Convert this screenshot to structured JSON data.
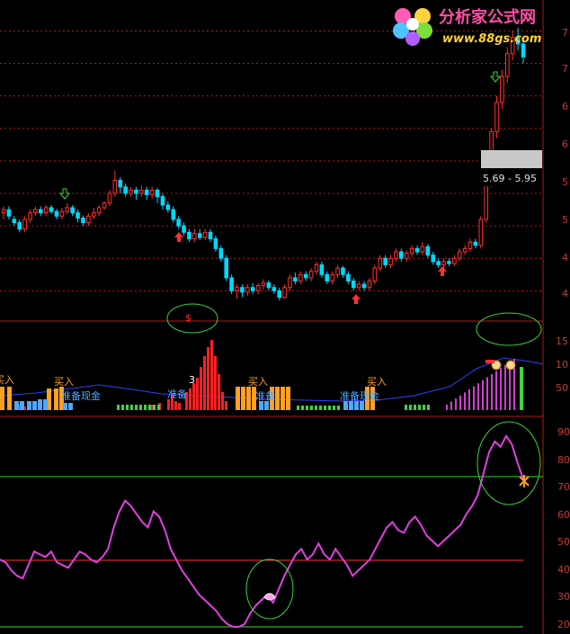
{
  "logo": {
    "title": "分析家公式网",
    "url": "www.88gs.com"
  },
  "range_box": {
    "text": "5.69 - 5.95"
  },
  "markers": {
    "dollar": "$",
    "three": "3"
  },
  "signals": {
    "buy": "买入",
    "ready": "准备",
    "ready_cash": "准备现金"
  },
  "axis": {
    "price_ticks": [
      "7",
      "7",
      "6",
      "6",
      "5",
      "5",
      "4",
      "4",
      "4"
    ],
    "vol_ticks": [
      "15",
      "10",
      "50"
    ],
    "osc_ticks": [
      "90",
      "80",
      "70",
      "60",
      "50",
      "40",
      "30",
      "20"
    ]
  },
  "colors": {
    "up": "#ff3030",
    "down": "#00d8ff",
    "panel_border": "#b01818",
    "osc_line": "#e040e0",
    "circle": "#3cd43c"
  },
  "chart_data": [
    {
      "type": "candlestick",
      "y_tick_labels": [
        "7",
        "7",
        "6",
        "6",
        "5",
        "5",
        "4",
        "4",
        "4"
      ],
      "range_label": "5.69 - 5.95",
      "candles": [
        [
          4.7,
          4.75,
          4.6,
          4.8
        ],
        [
          4.75,
          4.65,
          4.6,
          4.8
        ],
        [
          4.6,
          4.55,
          4.5,
          4.65
        ],
        [
          4.55,
          4.45,
          4.4,
          4.6
        ],
        [
          4.45,
          4.6,
          4.4,
          4.65
        ],
        [
          4.6,
          4.7,
          4.55,
          4.75
        ],
        [
          4.7,
          4.75,
          4.65,
          4.8
        ],
        [
          4.75,
          4.7,
          4.65,
          4.8
        ],
        [
          4.7,
          4.78,
          4.65,
          4.82
        ],
        [
          4.78,
          4.72,
          4.68,
          4.82
        ],
        [
          4.72,
          4.65,
          4.6,
          4.76
        ],
        [
          4.65,
          4.72,
          4.6,
          4.78
        ],
        [
          4.72,
          4.78,
          4.68,
          4.85
        ],
        [
          4.78,
          4.7,
          4.65,
          4.82
        ],
        [
          4.7,
          4.62,
          4.55,
          4.75
        ],
        [
          4.62,
          4.55,
          4.5,
          4.66
        ],
        [
          4.55,
          4.65,
          4.5,
          4.7
        ],
        [
          4.65,
          4.7,
          4.6,
          4.78
        ],
        [
          4.7,
          4.78,
          4.65,
          4.82
        ],
        [
          4.78,
          4.85,
          4.75,
          4.88
        ],
        [
          4.85,
          5.0,
          4.8,
          5.05
        ],
        [
          5.0,
          5.2,
          4.95,
          5.35
        ],
        [
          5.2,
          5.1,
          5.0,
          5.25
        ],
        [
          5.1,
          5.0,
          4.95,
          5.15
        ],
        [
          5.0,
          5.05,
          4.95,
          5.1
        ],
        [
          5.05,
          5.0,
          4.9,
          5.1
        ],
        [
          5.0,
          5.05,
          4.95,
          5.12
        ],
        [
          5.05,
          4.98,
          4.9,
          5.1
        ],
        [
          4.98,
          5.05,
          4.92,
          5.1
        ],
        [
          5.05,
          4.95,
          4.85,
          5.08
        ],
        [
          4.95,
          4.82,
          4.75,
          5.0
        ],
        [
          4.82,
          4.75,
          4.7,
          4.88
        ],
        [
          4.75,
          4.6,
          4.55,
          4.8
        ],
        [
          4.6,
          4.5,
          4.45,
          4.65
        ],
        [
          4.5,
          4.4,
          4.35,
          4.55
        ],
        [
          4.4,
          4.3,
          4.25,
          4.45
        ],
        [
          4.3,
          4.38,
          4.25,
          4.45
        ],
        [
          4.38,
          4.32,
          4.28,
          4.45
        ],
        [
          4.32,
          4.4,
          4.28,
          4.45
        ],
        [
          4.4,
          4.3,
          4.25,
          4.45
        ],
        [
          4.3,
          4.15,
          4.1,
          4.35
        ],
        [
          4.15,
          4.0,
          3.95,
          4.2
        ],
        [
          4.0,
          3.7,
          3.65,
          4.05
        ],
        [
          3.7,
          3.5,
          3.45,
          3.75
        ],
        [
          3.5,
          3.55,
          3.38,
          3.6
        ],
        [
          3.55,
          3.48,
          3.4,
          3.6
        ],
        [
          3.48,
          3.55,
          3.42,
          3.6
        ],
        [
          3.55,
          3.5,
          3.45,
          3.62
        ],
        [
          3.5,
          3.58,
          3.45,
          3.62
        ],
        [
          3.58,
          3.62,
          3.52,
          3.68
        ],
        [
          3.62,
          3.55,
          3.5,
          3.66
        ],
        [
          3.55,
          3.5,
          3.45,
          3.6
        ],
        [
          3.5,
          3.4,
          3.35,
          3.55
        ],
        [
          3.4,
          3.55,
          3.38,
          3.6
        ],
        [
          3.55,
          3.7,
          3.5,
          3.75
        ],
        [
          3.7,
          3.65,
          3.6,
          3.78
        ],
        [
          3.65,
          3.75,
          3.6,
          3.8
        ],
        [
          3.75,
          3.7,
          3.65,
          3.8
        ],
        [
          3.7,
          3.8,
          3.65,
          3.85
        ],
        [
          3.8,
          3.9,
          3.75,
          3.95
        ],
        [
          3.9,
          3.75,
          3.7,
          3.95
        ],
        [
          3.75,
          3.65,
          3.6,
          3.8
        ],
        [
          3.65,
          3.75,
          3.6,
          3.8
        ],
        [
          3.75,
          3.85,
          3.7,
          3.9
        ],
        [
          3.85,
          3.75,
          3.7,
          3.88
        ],
        [
          3.75,
          3.65,
          3.6,
          3.8
        ],
        [
          3.65,
          3.55,
          3.5,
          3.7
        ],
        [
          3.55,
          3.6,
          3.5,
          3.65
        ],
        [
          3.6,
          3.55,
          3.5,
          3.65
        ],
        [
          3.55,
          3.65,
          3.5,
          3.7
        ],
        [
          3.65,
          3.85,
          3.6,
          3.9
        ],
        [
          3.85,
          4.0,
          3.8,
          4.05
        ],
        [
          4.0,
          3.9,
          3.85,
          4.05
        ],
        [
          3.9,
          4.0,
          3.85,
          4.05
        ],
        [
          4.0,
          4.1,
          3.95,
          4.15
        ],
        [
          4.1,
          4.0,
          3.95,
          4.15
        ],
        [
          4.0,
          4.08,
          3.95,
          4.12
        ],
        [
          4.08,
          4.15,
          4.02,
          4.2
        ],
        [
          4.15,
          4.1,
          4.05,
          4.2
        ],
        [
          4.1,
          4.18,
          4.05,
          4.25
        ],
        [
          4.18,
          4.05,
          4.0,
          4.22
        ],
        [
          4.05,
          3.95,
          3.9,
          4.1
        ],
        [
          3.95,
          3.9,
          3.85,
          4.0
        ],
        [
          3.9,
          3.95,
          3.85,
          4.0
        ],
        [
          3.95,
          3.92,
          3.88,
          4.0
        ],
        [
          3.92,
          4.0,
          3.88,
          4.05
        ],
        [
          4.0,
          4.1,
          3.95,
          4.15
        ],
        [
          4.1,
          4.15,
          4.05,
          4.2
        ],
        [
          4.15,
          4.25,
          4.1,
          4.3
        ],
        [
          4.25,
          4.2,
          4.15,
          4.3
        ],
        [
          4.2,
          4.6,
          4.15,
          4.65
        ],
        [
          4.6,
          5.2,
          4.55,
          5.3
        ],
        [
          5.2,
          5.95,
          5.1,
          6.0
        ],
        [
          5.95,
          6.4,
          5.85,
          6.5
        ],
        [
          6.4,
          6.8,
          6.3,
          6.9
        ],
        [
          6.8,
          7.15,
          6.7,
          7.25
        ],
        [
          7.15,
          7.4,
          7.05,
          7.5
        ],
        [
          7.4,
          7.3,
          7.2,
          7.55
        ],
        [
          7.3,
          7.1,
          7.0,
          7.4
        ]
      ]
    },
    {
      "type": "bar",
      "y_tick_labels": [
        "15",
        "10",
        "50"
      ]
    },
    {
      "type": "line",
      "ylim": [
        20,
        95
      ],
      "y_tick_labels": [
        "90",
        "80",
        "70",
        "60",
        "50",
        "40",
        "30",
        "20"
      ],
      "reference_lines": [
        75,
        45,
        22
      ],
      "values": [
        44,
        43,
        40,
        38,
        37,
        42,
        47,
        46,
        45,
        47,
        43,
        42,
        41,
        44,
        47,
        46,
        44,
        43,
        45,
        48,
        56,
        62,
        66,
        64,
        61,
        58,
        56,
        62,
        60,
        55,
        48,
        44,
        40,
        37,
        34,
        31,
        29,
        27,
        25,
        22,
        20,
        19,
        19,
        20,
        24,
        27,
        29,
        31,
        28,
        33,
        38,
        42,
        46,
        48,
        44,
        46,
        50,
        46,
        44,
        48,
        45,
        42,
        38,
        40,
        42,
        44,
        48,
        52,
        56,
        58,
        55,
        54,
        58,
        60,
        57,
        53,
        51,
        49,
        51,
        53,
        55,
        57,
        61,
        64,
        68,
        76,
        84,
        88,
        86,
        90,
        87,
        80,
        74
      ]
    }
  ]
}
